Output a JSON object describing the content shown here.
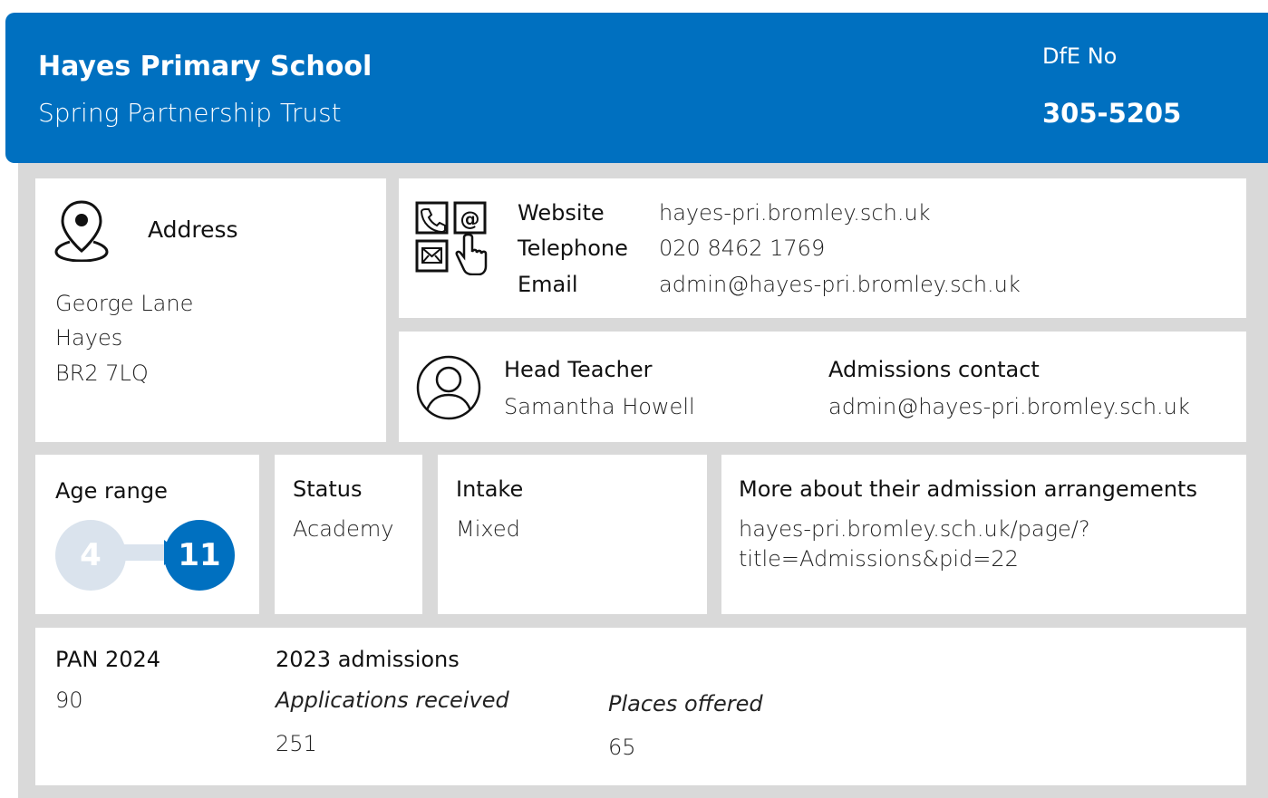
{
  "header": {
    "school_name": "Hayes Primary School",
    "trust": "Spring Partnership Trust",
    "dfe_label": "DfE No",
    "dfe_number": "305-5205"
  },
  "address": {
    "heading": "Address",
    "lines": [
      "George Lane",
      "Hayes",
      "BR2 7LQ"
    ],
    "icon": "map-pin-icon"
  },
  "contact": {
    "icon": "contact-methods-icon",
    "website_label": "Website",
    "website": "hayes-pri.bromley.sch.uk",
    "telephone_label": "Telephone",
    "telephone": "020 8462 1769",
    "email_label": "Email",
    "email": "admin@hayes-pri.bromley.sch.uk"
  },
  "people": {
    "icon": "person-icon",
    "head_label": "Head Teacher",
    "head_name": "Samantha Howell",
    "admissions_label": "Admissions contact",
    "admissions_email": "admin@hayes-pri.bromley.sch.uk"
  },
  "age": {
    "label": "Age range",
    "from": "4",
    "to": "11"
  },
  "status": {
    "label": "Status",
    "value": "Academy"
  },
  "intake": {
    "label": "Intake",
    "value": "Mixed"
  },
  "arrangements": {
    "label": "More about their admission arrangements",
    "link_line1": "hayes-pri.bromley.sch.uk/page/?",
    "link_line2": "title=Admissions&pid=22"
  },
  "pan": {
    "label": "PAN 2024",
    "value": "90"
  },
  "admissions_2023": {
    "label": "2023 admissions",
    "applications_label": "Applications received",
    "applications": "251",
    "places_label": "Places offered",
    "places": "65"
  },
  "colors": {
    "brand_blue": "#0070c0",
    "panel_grey": "#d9d9d9",
    "age_from_circle": "#dae3ed",
    "age_to_circle": "#0070c0"
  }
}
